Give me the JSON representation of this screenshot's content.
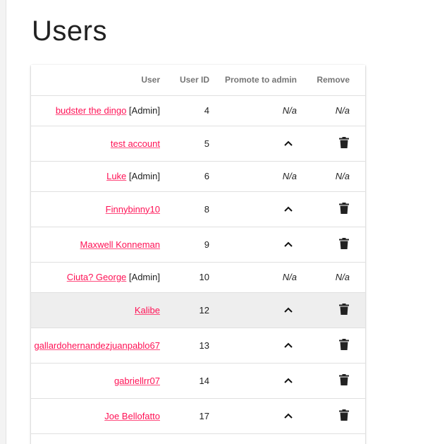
{
  "page": {
    "title": "Users"
  },
  "table": {
    "headers": {
      "user": "User",
      "user_id": "User ID",
      "promote": "Promote to admin",
      "remove": "Remove"
    },
    "rows": [
      {
        "name": "budster the dingo",
        "admin": "[Admin]",
        "id": "4",
        "promote": "N/a",
        "remove": "N/a"
      },
      {
        "name": "test account",
        "admin": "",
        "id": "5",
        "promote": "chevron-up-icon",
        "remove": "trash-icon"
      },
      {
        "name": "Luke",
        "admin": "[Admin]",
        "id": "6",
        "promote": "N/a",
        "remove": "N/a"
      },
      {
        "name": "Finnybinny10",
        "admin": "",
        "id": "8",
        "promote": "chevron-up-icon",
        "remove": "trash-icon"
      },
      {
        "name": "Maxwell Konneman",
        "admin": "",
        "id": "9",
        "promote": "chevron-up-icon",
        "remove": "trash-icon"
      },
      {
        "name": "Ciuta? George",
        "admin": "[Admin]",
        "id": "10",
        "promote": "N/a",
        "remove": "N/a"
      },
      {
        "name": "Kalibe",
        "admin": "",
        "id": "12",
        "promote": "chevron-up-icon",
        "remove": "trash-icon"
      },
      {
        "name": "gallardohernandezjuanpablo67",
        "admin": "",
        "id": "13",
        "promote": "chevron-up-icon",
        "remove": "trash-icon"
      },
      {
        "name": "gabriellrr07",
        "admin": "",
        "id": "14",
        "promote": "chevron-up-icon",
        "remove": "trash-icon"
      },
      {
        "name": "Joe Bellofatto",
        "admin": "",
        "id": "17",
        "promote": "chevron-up-icon",
        "remove": "trash-icon"
      }
    ]
  },
  "colors": {
    "link": "#ff1155",
    "highlight_row": "#eeeeee",
    "text": "#212121",
    "header_text": "#757575"
  }
}
